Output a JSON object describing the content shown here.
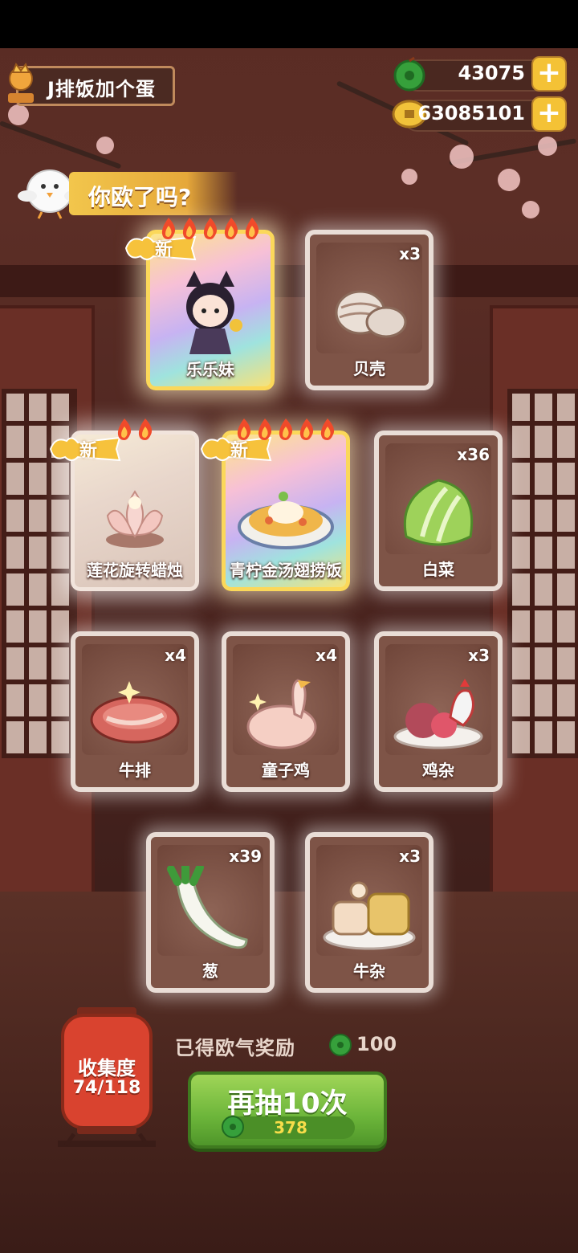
{
  "player": {
    "name": "J排饭加个蛋"
  },
  "currency": {
    "jade": "43075",
    "coins": "63085101"
  },
  "title": "你欧了吗?",
  "new_label": "新",
  "cards": [
    {
      "name": "乐乐妹",
      "count": "",
      "is_new": true,
      "flames": 5,
      "art": "girl-character-icon"
    },
    {
      "name": "贝壳",
      "count": "x3",
      "is_new": false,
      "flames": 0,
      "art": "shell-icon"
    },
    {
      "name": "莲花旋转蜡烛",
      "count": "",
      "is_new": true,
      "flames": 2,
      "art": "lotus-candle-icon"
    },
    {
      "name": "青柠金汤翅捞饭",
      "count": "",
      "is_new": true,
      "flames": 5,
      "art": "rice-dish-icon"
    },
    {
      "name": "白菜",
      "count": "x36",
      "is_new": false,
      "flames": 0,
      "art": "cabbage-icon"
    },
    {
      "name": "牛排",
      "count": "x4",
      "is_new": false,
      "flames": 0,
      "art": "steak-icon"
    },
    {
      "name": "童子鸡",
      "count": "x4",
      "is_new": false,
      "flames": 0,
      "art": "chicken-icon"
    },
    {
      "name": "鸡杂",
      "count": "x3",
      "is_new": false,
      "flames": 0,
      "art": "giblets-icon"
    },
    {
      "name": "葱",
      "count": "x39",
      "is_new": false,
      "flames": 0,
      "art": "scallion-icon"
    },
    {
      "name": "牛杂",
      "count": "x3",
      "is_new": false,
      "flames": 0,
      "art": "beef-offal-icon"
    }
  ],
  "collection": {
    "label": "收集度",
    "progress": "74/118"
  },
  "reward": {
    "label": "已得欧气奖励",
    "value": "100"
  },
  "draw": {
    "label": "再抽10次",
    "cost": "378"
  },
  "colors": {
    "accent_green": "#6cb53a",
    "gold": "#f4c236",
    "card_bg": "#7e5447"
  }
}
